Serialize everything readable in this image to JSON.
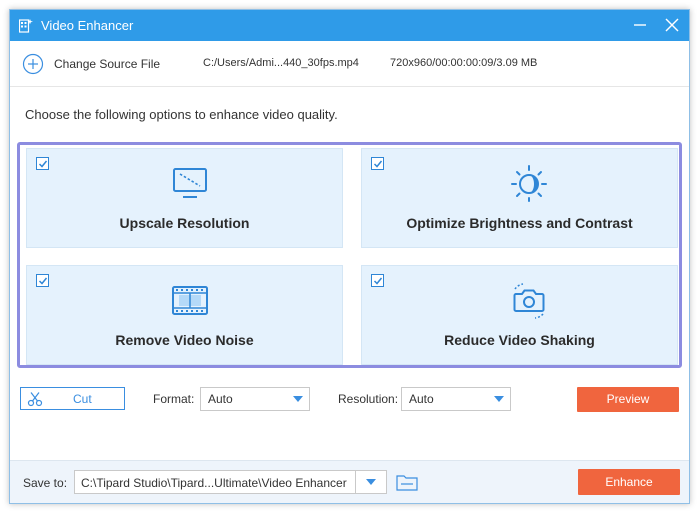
{
  "window": {
    "title": "Video Enhancer"
  },
  "source": {
    "change_label": "Change Source File",
    "file_path": "C:/Users/Admi...440_30fps.mp4",
    "file_info": "720x960/00:00:00:09/3.09 MB"
  },
  "instructions": "Choose the following options to enhance video quality.",
  "options": [
    {
      "label": "Upscale Resolution",
      "checked": true,
      "icon": "monitor-icon"
    },
    {
      "label": "Optimize Brightness and Contrast",
      "checked": true,
      "icon": "brightness-icon"
    },
    {
      "label": "Remove Video Noise",
      "checked": true,
      "icon": "film-icon"
    },
    {
      "label": "Reduce Video Shaking",
      "checked": true,
      "icon": "camera-icon"
    }
  ],
  "settings": {
    "cut_label": "Cut",
    "format_label": "Format:",
    "format_value": "Auto",
    "resolution_label": "Resolution:",
    "resolution_value": "Auto",
    "preview_label": "Preview"
  },
  "footer": {
    "save_label": "Save to:",
    "save_path": "C:\\Tipard Studio\\Tipard...Ultimate\\Video Enhancer",
    "enhance_label": "Enhance"
  },
  "colors": {
    "titlebar": "#2f9be8",
    "accent": "#3a8ee0",
    "button_primary": "#f0653e",
    "card_bg": "#e5f2fd",
    "frame_highlight": "#8c8ce0"
  }
}
